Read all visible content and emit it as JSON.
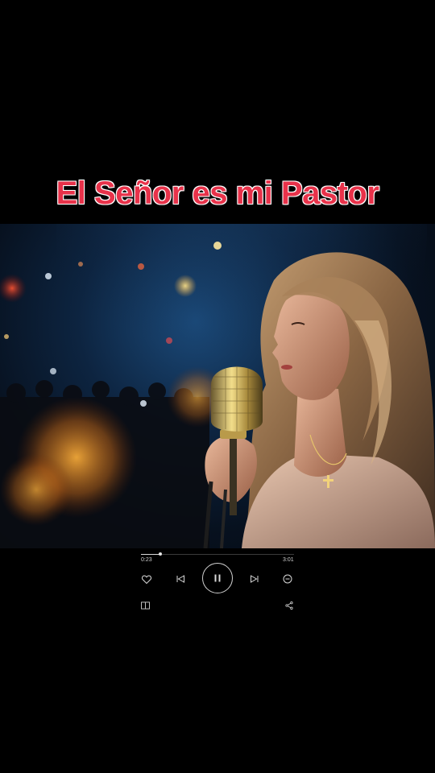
{
  "video": {
    "title_text": "El Señor es mi Pastor",
    "title_color": "#e8324a"
  },
  "player": {
    "elapsed": "0:23",
    "duration": "3:01",
    "progress_fraction": 0.127,
    "state": "playing",
    "icons": [
      "heart-icon",
      "previous-icon",
      "pause-icon",
      "next-icon",
      "minus-circle-icon",
      "playlist-icon",
      "share-icon"
    ]
  }
}
